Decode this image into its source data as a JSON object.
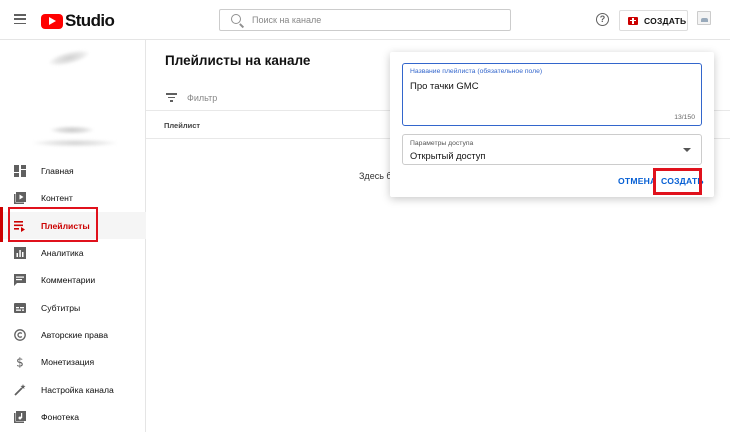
{
  "header": {
    "logo_text": "Studio",
    "search_placeholder": "Поиск на канале",
    "help_glyph": "?",
    "create_label": "СОЗДАТЬ"
  },
  "sidebar": {
    "items": [
      {
        "label": "Главная",
        "icon": "dashboard-icon"
      },
      {
        "label": "Контент",
        "icon": "video-library-icon"
      },
      {
        "label": "Плейлисты",
        "icon": "playlist-icon",
        "active": true
      },
      {
        "label": "Аналитика",
        "icon": "analytics-icon"
      },
      {
        "label": "Комментарии",
        "icon": "comments-icon"
      },
      {
        "label": "Субтитры",
        "icon": "subtitles-icon"
      },
      {
        "label": "Авторские права",
        "icon": "copyright-icon"
      },
      {
        "label": "Монетизация",
        "icon": "dollar-icon"
      },
      {
        "label": "Настройка канала",
        "icon": "magic-wand-icon"
      },
      {
        "label": "Фонотека",
        "icon": "audio-library-icon"
      }
    ]
  },
  "main": {
    "title": "Плейлисты на канале",
    "filter_label": "Фильтр",
    "column_header": "Плейлист",
    "empty_text": "Здесь б"
  },
  "dialog": {
    "name_caption": "Название плейлиста (обязательное поле)",
    "name_value": "Про тачки GMC",
    "name_count": "13/150",
    "access_caption": "Параметры доступа",
    "access_value": "Открытый доступ",
    "cancel_label": "ОТМЕНА",
    "confirm_label": "СОЗДАТЬ"
  },
  "colors": {
    "brand_red": "#ff0000",
    "active_red": "#cc0000",
    "highlight_red": "#e0111c",
    "link_blue": "#065fd4",
    "focus_blue": "#3366cc"
  }
}
